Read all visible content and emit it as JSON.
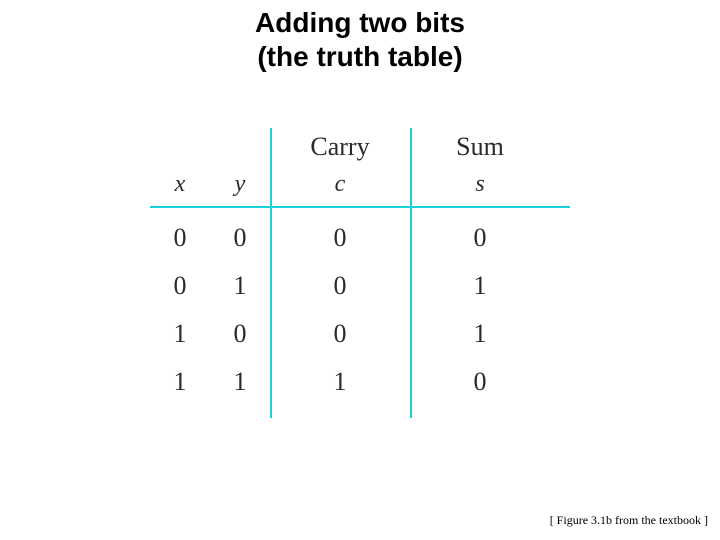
{
  "title": "Adding two bits\n(the truth table)",
  "table": {
    "headers": {
      "carry": "Carry",
      "sum": "Sum",
      "x": "x",
      "y": "y",
      "c": "c",
      "s": "s"
    },
    "rows": [
      {
        "x": "0",
        "y": "0",
        "c": "0",
        "s": "0"
      },
      {
        "x": "0",
        "y": "1",
        "c": "0",
        "s": "1"
      },
      {
        "x": "1",
        "y": "0",
        "c": "0",
        "s": "1"
      },
      {
        "x": "1",
        "y": "1",
        "c": "1",
        "s": "0"
      }
    ]
  },
  "caption": "[ Figure 3.1b from the textbook ]",
  "colors": {
    "rule": "#18d2d8"
  },
  "chart_data": {
    "type": "table",
    "title": "Adding two bits (the truth table)",
    "columns": [
      "x",
      "y",
      "Carry c",
      "Sum s"
    ],
    "rows": [
      [
        0,
        0,
        0,
        0
      ],
      [
        0,
        1,
        0,
        1
      ],
      [
        1,
        0,
        0,
        1
      ],
      [
        1,
        1,
        1,
        0
      ]
    ]
  }
}
